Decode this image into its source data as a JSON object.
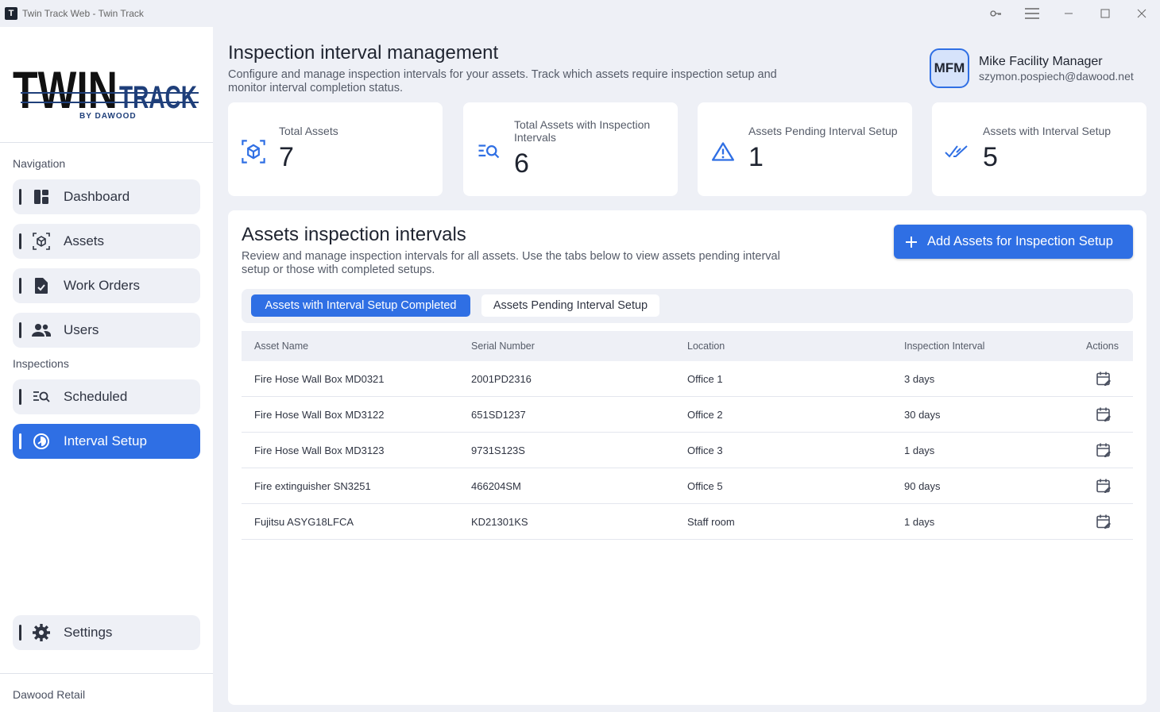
{
  "window": {
    "app_icon_letter": "T",
    "title": "Twin Track Web - Twin Track"
  },
  "logo": {
    "word1": "TWIN",
    "word2": "TRACK",
    "byline": "BY DAWOOD"
  },
  "sidebar": {
    "navigation_label": "Navigation",
    "inspections_label": "Inspections",
    "items": [
      {
        "label": "Dashboard",
        "icon": "dashboard-icon"
      },
      {
        "label": "Assets",
        "icon": "assets-icon"
      },
      {
        "label": "Work Orders",
        "icon": "work-orders-icon"
      },
      {
        "label": "Users",
        "icon": "users-icon"
      },
      {
        "label": "Scheduled",
        "icon": "scheduled-icon"
      },
      {
        "label": "Interval Setup",
        "icon": "interval-icon",
        "active": true
      }
    ],
    "settings_label": "Settings",
    "org_name": "Dawood Retail"
  },
  "header": {
    "title": "Inspection interval management",
    "description": "Configure and manage inspection intervals for your assets. Track which assets require inspection setup and monitor interval completion status."
  },
  "user": {
    "initials": "MFM",
    "name": "Mike Facility Manager",
    "email": "szymon.pospiech@dawood.net"
  },
  "stats": [
    {
      "label": "Total Assets",
      "value": "7",
      "icon": "cube-icon"
    },
    {
      "label": "Total Assets with Inspection Intervals",
      "value": "6",
      "icon": "list-search-icon"
    },
    {
      "label": "Assets Pending Interval Setup",
      "value": "1",
      "icon": "warning-icon"
    },
    {
      "label": "Assets with Interval Setup",
      "value": "5",
      "icon": "double-check-icon"
    }
  ],
  "panel": {
    "title": "Assets inspection intervals",
    "description": "Review and manage inspection intervals for all assets. Use the tabs below to view assets pending interval setup or those with completed setups.",
    "add_button_label": "Add Assets for Inspection Setup",
    "tabs": [
      {
        "label": "Assets with Interval Setup Completed",
        "active": true
      },
      {
        "label": "Assets Pending Interval Setup",
        "active": false
      }
    ],
    "columns": [
      "Asset Name",
      "Serial Number",
      "Location",
      "Inspection Interval",
      "Actions"
    ],
    "rows": [
      {
        "name": "Fire Hose Wall Box MD0321",
        "serial": "2001PD2316",
        "location": "Office 1",
        "interval": "3 days"
      },
      {
        "name": "Fire Hose Wall Box MD3122",
        "serial": "651SD1237",
        "location": "Office 2",
        "interval": "30 days"
      },
      {
        "name": "Fire Hose Wall Box MD3123",
        "serial": "9731S123S",
        "location": "Office 3",
        "interval": "1 days"
      },
      {
        "name": "Fire extinguisher SN3251",
        "serial": "466204SM",
        "location": "Office 5",
        "interval": "90 days"
      },
      {
        "name": "Fujitsu ASYG18LFCA",
        "serial": "KD21301KS",
        "location": "Staff room",
        "interval": "1 days"
      }
    ]
  },
  "colors": {
    "accent": "#2f6fe4",
    "background": "#eef0f6",
    "card": "#ffffff"
  }
}
